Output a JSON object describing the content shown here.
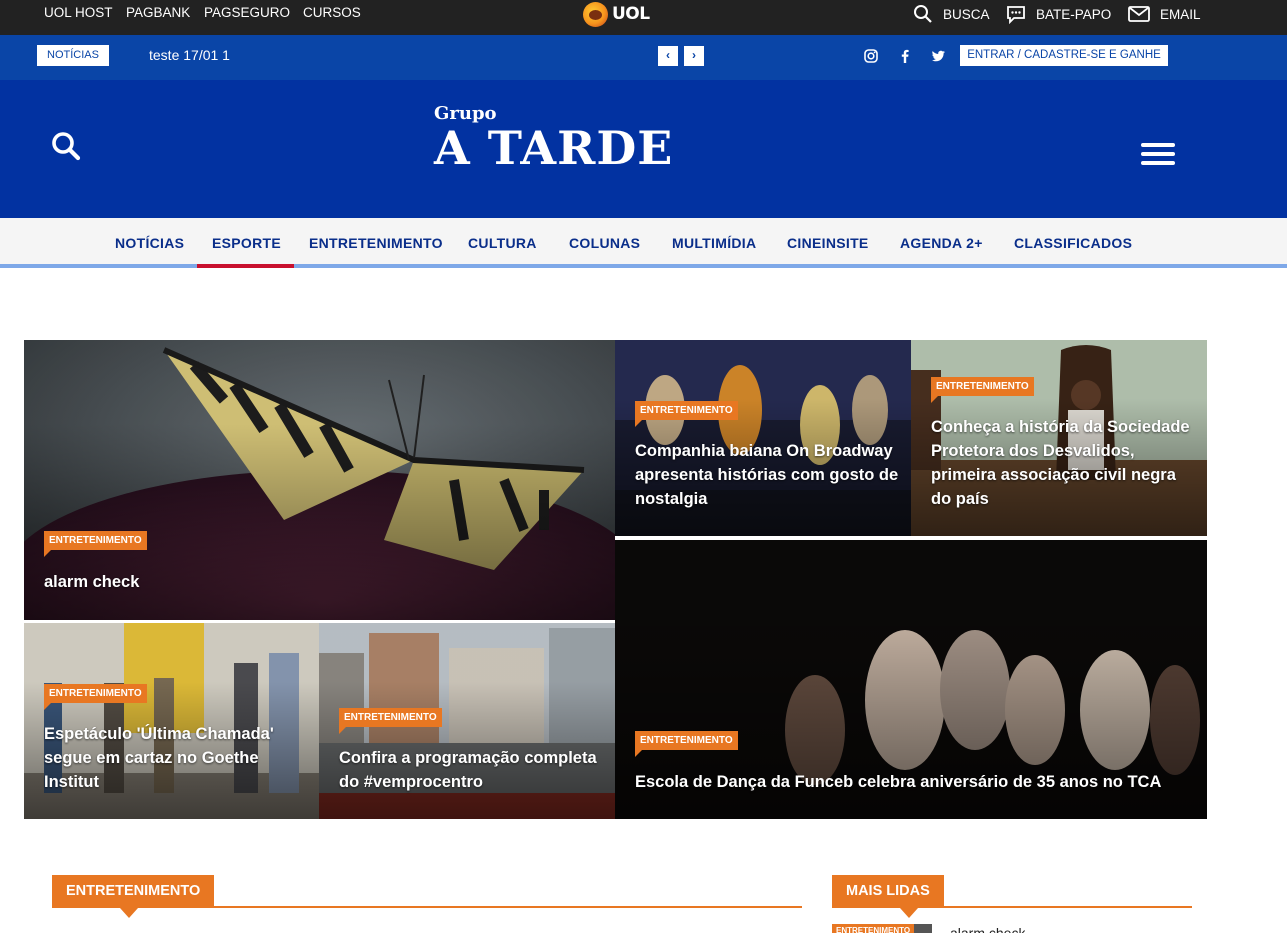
{
  "uol_bar": {
    "links": [
      "UOL HOST",
      "PAGBANK",
      "PAGSEGURO",
      "CURSOS"
    ],
    "logo_text": "UOL",
    "tools": {
      "search": "BUSCA",
      "chat": "BATE-PAPO",
      "email": "EMAIL"
    }
  },
  "ticker": {
    "badge": "NOTÍCIAS",
    "text": "teste 17/01 1",
    "prev": "‹",
    "next": "›",
    "login": "ENTRAR / CADASTRE-SE E GANHE"
  },
  "masthead": {
    "logo_small": "Grupo",
    "logo_big": "A TARDE"
  },
  "nav": {
    "items": [
      "NOTÍCIAS",
      "ESPORTE",
      "ENTRETENIMENTO",
      "CULTURA",
      "COLUNAS",
      "MULTIMÍDIA",
      "CINEINSITE",
      "AGENDA 2+",
      "CLASSIFICADOS"
    ],
    "active": "ESPORTE"
  },
  "news": [
    {
      "tag": "ENTRETENIMENTO",
      "title": "alarm check"
    },
    {
      "tag": "ENTRETENIMENTO",
      "title": "Companhia baiana On Broadway apresenta histórias com gosto de nostalgia"
    },
    {
      "tag": "ENTRETENIMENTO",
      "title": "Conheça a história da Sociedade Protetora dos Desvalidos, primeira associação civil negra do país"
    },
    {
      "tag": "ENTRETENIMENTO",
      "title": "Espetáculo 'Última Chamada' segue em cartaz no Goethe Institut"
    },
    {
      "tag": "ENTRETENIMENTO",
      "title": "Confira a programação completa do #vemprocentro"
    },
    {
      "tag": "ENTRETENIMENTO",
      "title": "Escola de Dança da Funceb celebra aniversário de 35 anos no TCA"
    }
  ],
  "sections": {
    "left": "ENTRETENIMENTO",
    "right": "MAIS LIDAS",
    "most_read_first": "alarm check",
    "most_read_first_tag": "ENTRETENIMENTO"
  },
  "colors": {
    "uol_bar": "#222222",
    "ticker": "#0a45a7",
    "masthead": "#0232a1",
    "accent": "#e87722",
    "nav_text": "#0a2e8a",
    "nav_active": "#c8102e"
  }
}
